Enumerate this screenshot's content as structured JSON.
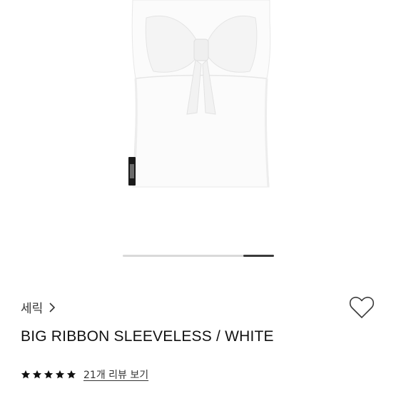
{
  "product": {
    "brand": "세릭",
    "title": "BIG RIBBON SLEEVELESS / WHITE",
    "rating": {
      "stars": 5,
      "max": 5
    },
    "reviews_link": "21개 리뷰 보기"
  },
  "gallery": {
    "slider_position": 0.8
  },
  "icons": {
    "brand_chevron": "chevron-right-icon",
    "wishlist": "heart-icon",
    "rating": "star-icon"
  },
  "colors": {
    "text": "#111111",
    "secondary_text": "#333333",
    "track": "#d9d9d9",
    "thumb": "#3a3a3a"
  }
}
